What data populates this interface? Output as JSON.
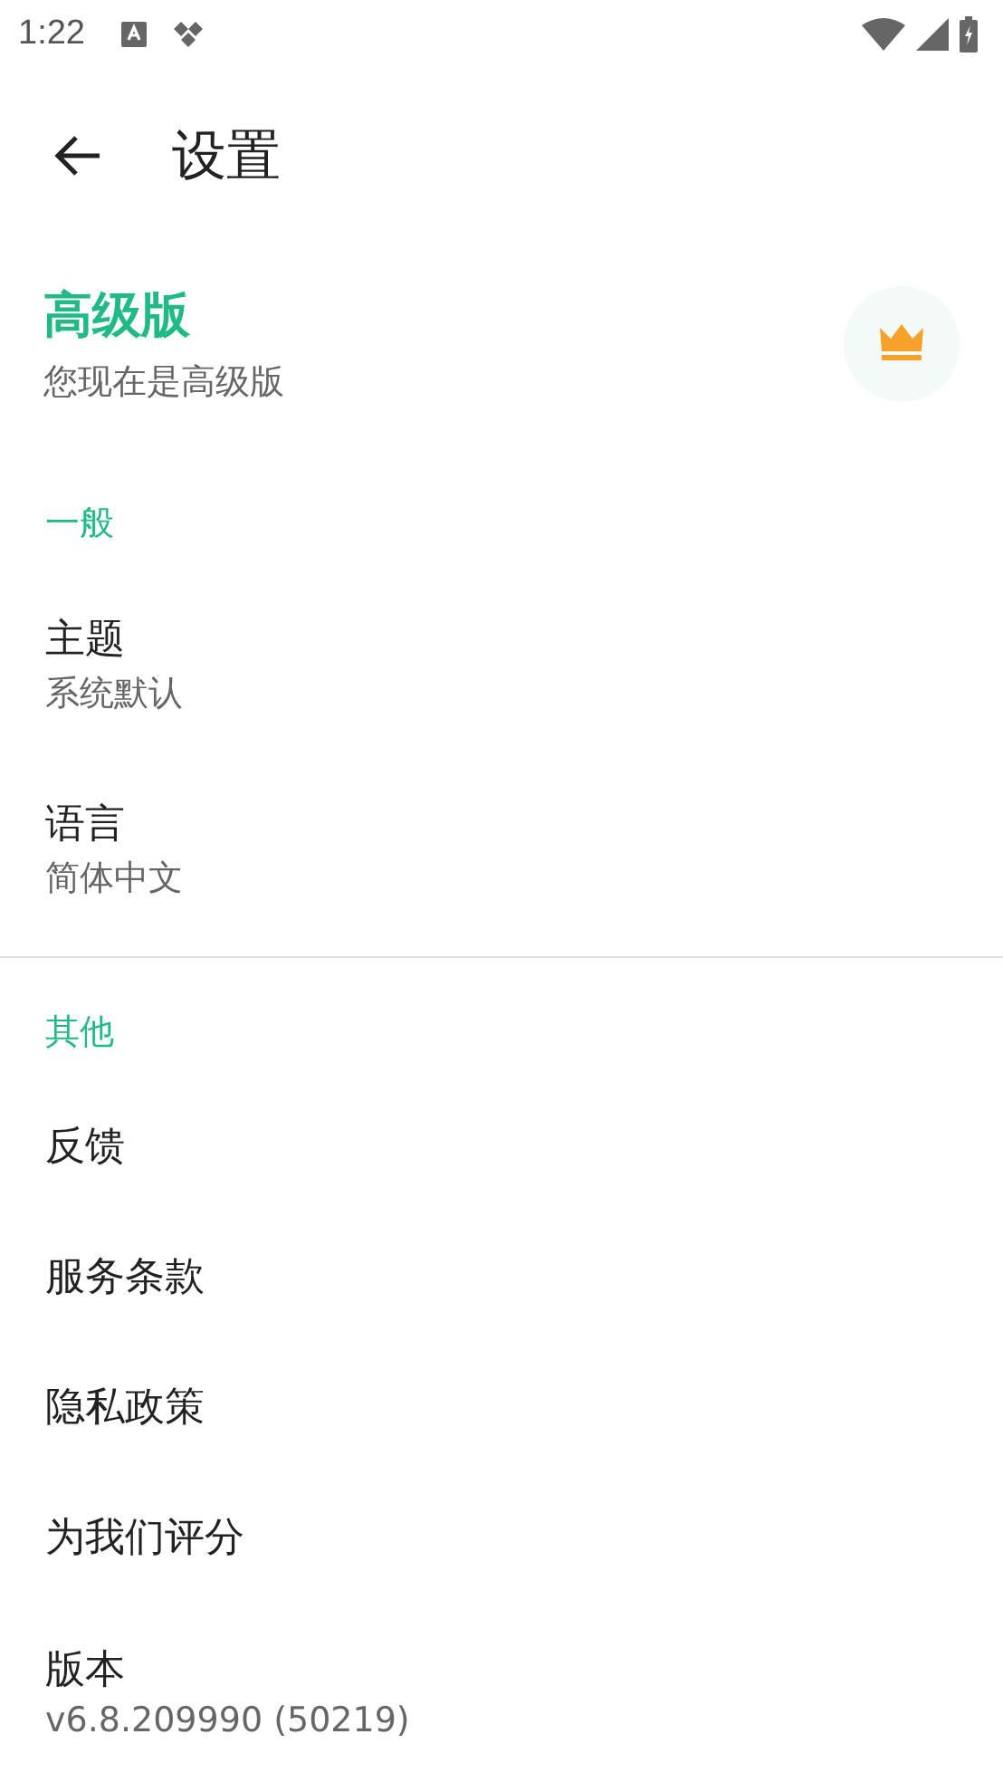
{
  "status_bar": {
    "time": "1:22"
  },
  "app_bar": {
    "title": "设置"
  },
  "premium": {
    "title": "高级版",
    "subtitle": "您现在是高级版"
  },
  "sections": [
    {
      "header": "一般",
      "divider_after": true,
      "items": [
        {
          "title": "主题",
          "subtitle": "系统默认"
        },
        {
          "title": "语言",
          "subtitle": "简体中文"
        }
      ]
    },
    {
      "header": "其他",
      "divider_after": false,
      "items": [
        {
          "title": "反馈"
        },
        {
          "title": "服务条款"
        },
        {
          "title": "隐私政策"
        },
        {
          "title": "为我们评分"
        },
        {
          "title": "版本",
          "subtitle": "v6.8.209990 (50219)"
        }
      ]
    }
  ]
}
